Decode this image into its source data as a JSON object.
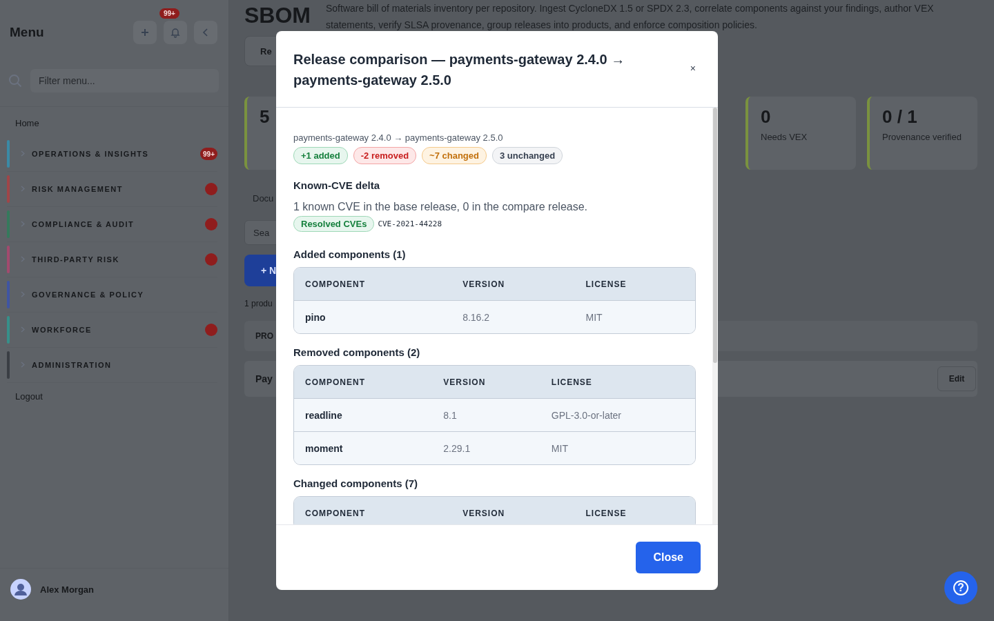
{
  "sidebar": {
    "title": "Menu",
    "notification_badge": "99+",
    "filter": {
      "placeholder": "Filter menu..."
    },
    "home": "Home",
    "sections": [
      {
        "label": "OPERATIONS & INSIGHTS",
        "color": "#3a8aa6",
        "has_badge": true,
        "badge_text": "99+"
      },
      {
        "label": "RISK MANAGEMENT",
        "color": "#a04548",
        "has_badge": true
      },
      {
        "label": "COMPLIANCE & AUDIT",
        "color": "#357a5c",
        "has_badge": true
      },
      {
        "label": "THIRD-PARTY RISK",
        "color": "#a24a6e",
        "has_badge": true
      },
      {
        "label": "GOVERNANCE & POLICY",
        "color": "#3f55a3",
        "has_badge": false
      },
      {
        "label": "WORKFORCE",
        "color": "#36908a",
        "has_badge": true
      },
      {
        "label": "ADMINISTRATION",
        "color": "#3a3e44",
        "has_badge": false
      }
    ],
    "logout": "Logout",
    "user": "Alex Morgan"
  },
  "main": {
    "title": "SBOM",
    "description": "Software bill of materials inventory per repository. Ingest CycloneDX 1.5 or SPDX 2.3, correlate components against your findings, author VEX statements, verify SLSA provenance, group releases into products, and enforce composition policies.",
    "tab": "Re",
    "stat_cards": [
      {
        "value": "5",
        "color": "#7a923f"
      },
      {
        "value": "0",
        "label": "Needs VEX",
        "color": "#7a923f"
      },
      {
        "value": "0 / 1",
        "label": "Provenance verified",
        "color": "#7a923f"
      }
    ],
    "section_label": "Docu",
    "search": {
      "placeholder": "Sea"
    },
    "add_button": "+ N",
    "count": "1 produ",
    "table_header": "PRO",
    "row_text": "Pay",
    "edit_button": "Edit"
  },
  "modal": {
    "title": "Release comparison — payments-gateway 2.4.0 → payments-gateway 2.5.0",
    "close_icon": "×",
    "subtitle": "payments-gateway 2.4.0 → payments-gateway 2.5.0",
    "chips": [
      {
        "label": "+1 added",
        "kind": "added"
      },
      {
        "label": "-2 removed",
        "kind": "removed"
      },
      {
        "label": "~7 changed",
        "kind": "changed"
      },
      {
        "label": "3 unchanged",
        "kind": "unchanged"
      }
    ],
    "cve_heading": "Known-CVE delta",
    "cve_text": "1 known CVE in the base release, 0 in the compare release.",
    "cve_tag": "Resolved CVEs",
    "cve_id": "CVE-2021-44228",
    "tables": [
      {
        "heading": "Added components (1)",
        "columns": [
          "COMPONENT",
          "VERSION",
          "LICENSE"
        ],
        "rows": [
          [
            "pino",
            "8.16.2",
            "MIT"
          ]
        ]
      },
      {
        "heading": "Removed components (2)",
        "columns": [
          "COMPONENT",
          "VERSION",
          "LICENSE"
        ],
        "rows": [
          [
            "readline",
            "8.1",
            "GPL-3.0-or-later"
          ],
          [
            "moment",
            "2.29.1",
            "MIT"
          ]
        ]
      },
      {
        "heading": "Changed components (7)",
        "columns": [
          "COMPONENT",
          "VERSION",
          "LICENSE"
        ]
      }
    ],
    "close_button": "Close"
  },
  "help_icon": "?"
}
